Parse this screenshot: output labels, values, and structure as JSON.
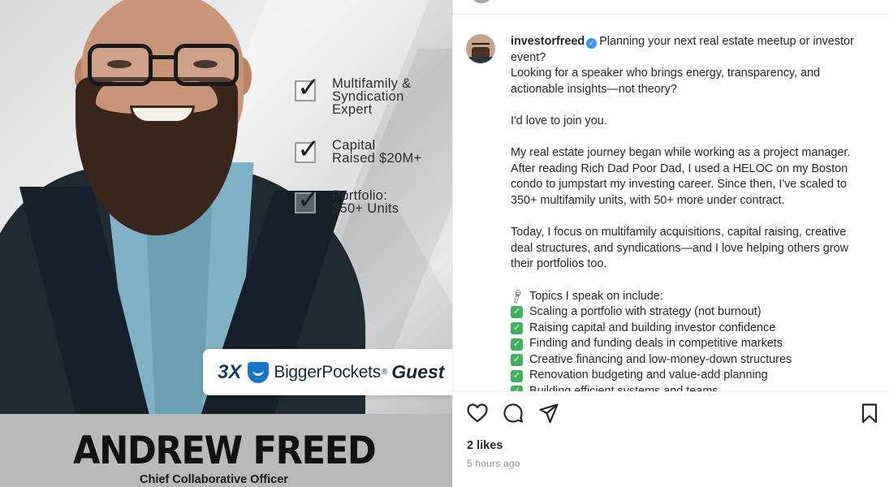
{
  "image": {
    "checklist": [
      {
        "lines": [
          "Multifamily &",
          "Syndication",
          "Expert"
        ]
      },
      {
        "lines": [
          "Capital",
          "Raised $20M+"
        ]
      },
      {
        "lines": [
          "Portfolio:",
          "350+ Units"
        ]
      }
    ],
    "badge": {
      "count": "3X",
      "brand": "BiggerPockets",
      "registered": "®",
      "suffix": "Guest"
    },
    "name": "ANDREW FREED",
    "title": "Chief Collaborative Officer"
  },
  "post": {
    "username": "investorfreed",
    "verified_icon": "verified-badge-icon",
    "caption_first": "Planning your next real estate meetup or investor",
    "caption_lines": [
      "event?",
      "Looking for a speaker who brings energy, transparency, and",
      "actionable insights—not theory?"
    ],
    "para2": "I'd love to join you.",
    "para3": [
      "My real estate journey began while working as a project manager.",
      "After reading Rich Dad Poor Dad, I used a HELOC on my Boston",
      "condo to jumpstart my investing career. Since then, I've scaled to",
      "350+ multifamily units, with 50+ more under contract."
    ],
    "para4": [
      "Today, I focus on multifamily acquisitions, capital raising, creative",
      "deal structures, and syndications—and I love helping others grow",
      "their portfolios too."
    ],
    "topics_heading": "Topics I speak on include:",
    "topics": [
      "Scaling a portfolio with strategy (not burnout)",
      "Raising capital and building investor confidence",
      "Finding and funding deals in competitive markets",
      "Creative financing and low-money-down structures",
      "Renovation budgeting and value-add planning",
      "Building efficient systems and teams"
    ],
    "likes": "2 likes",
    "timestamp": "5 hours ago",
    "actions": {
      "like_icon": "heart-icon",
      "comment_icon": "comment-icon",
      "share_icon": "send-icon",
      "save_icon": "bookmark-icon"
    },
    "colors": {
      "verified": "#3897f0",
      "check_emoji": "#3fb15a",
      "text": "#262626",
      "muted": "#8e8e8e"
    }
  }
}
